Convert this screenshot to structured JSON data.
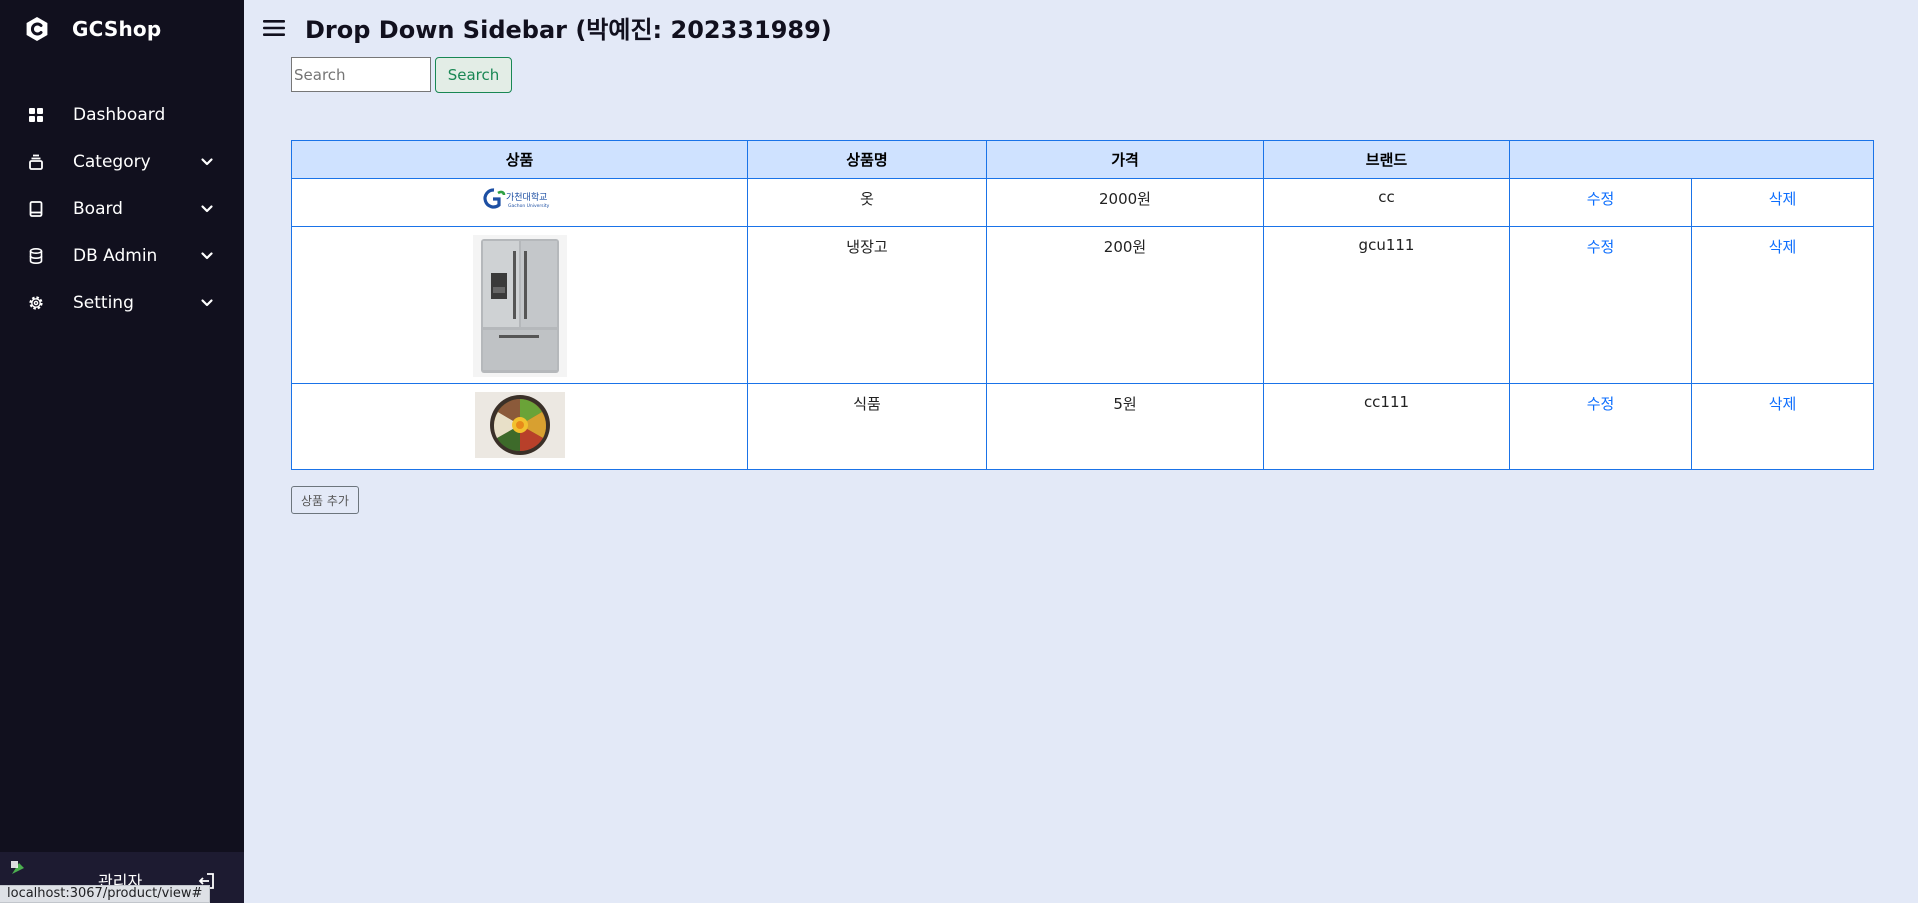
{
  "sidebar": {
    "brand": "GCShop",
    "items": [
      {
        "label": "Dashboard",
        "icon": "grid-icon"
      },
      {
        "label": "Category",
        "icon": "layers-icon"
      },
      {
        "label": "Board",
        "icon": "book-icon"
      },
      {
        "label": "DB Admin",
        "icon": "database-icon"
      },
      {
        "label": "Setting",
        "icon": "gear-icon"
      }
    ],
    "profile_name": "관리자"
  },
  "status_url": "localhost:3067/product/view#",
  "header": {
    "title": "Drop Down Sidebar (박예진: 202331989)"
  },
  "search": {
    "placeholder": "Search",
    "button_label": "Search"
  },
  "table": {
    "headers": [
      "상품",
      "상품명",
      "가격",
      "브랜드",
      ""
    ],
    "rows": [
      {
        "image": "gachon-university-logo",
        "name": "옷",
        "price": "2000원",
        "brand": "cc",
        "edit": "수정",
        "delete": "삭제"
      },
      {
        "image": "refrigerator-photo",
        "name": "냉장고",
        "price": "200원",
        "brand": "gcu111",
        "edit": "수정",
        "delete": "삭제"
      },
      {
        "image": "bibimbap-photo",
        "name": "식품",
        "price": "5원",
        "brand": "cc111",
        "edit": "수정",
        "delete": "삭제"
      }
    ],
    "logo_text_kr": "가천대학교",
    "logo_text_en": "Gachon University"
  },
  "add_button_label": "상품 추가",
  "colors": {
    "sidebar_bg": "#11101e",
    "page_bg": "#e3e9f7",
    "table_border": "#1a73e8",
    "table_header_bg": "#cfe2ff",
    "link": "#0d6efd",
    "search_button": "#198754"
  }
}
